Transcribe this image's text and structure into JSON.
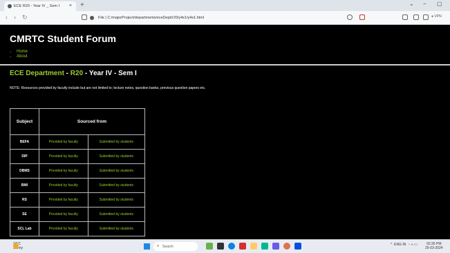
{
  "browser": {
    "tab_title": "ECE R20 - Year IV _ Sem I",
    "tab_close": "×",
    "new_tab": "+",
    "back": "‹",
    "forward": "›",
    "reload": "↻",
    "url": "File  |  C:/majorProject/departments/eceDept/r20/y4s1/y4s1.html",
    "vpn": "● VPN",
    "window_controls": [
      "⌄",
      "−",
      "▢"
    ]
  },
  "site": {
    "title": "CMRTC Student Forum",
    "nav": [
      "Home",
      "About"
    ]
  },
  "page": {
    "heading_dept": "ECE Department",
    "heading_sep1": " - ",
    "heading_reg": "R20",
    "heading_rest": " - Year IV - Sem I",
    "note": "NOTE: Resources provided by faculty include but are not limited to; lecture notes, question banks, previous question papers etc."
  },
  "table": {
    "header_subject": "Subject",
    "header_source": "Sourced from",
    "rows": [
      {
        "subject": "BEFA",
        "faculty": "Provided by faculty",
        "students": "Submitted by students"
      },
      {
        "subject": "DIP",
        "faculty": "Provided by faculty",
        "students": "Submitted by students"
      },
      {
        "subject": "DBMS",
        "faculty": "Provided by faculty",
        "students": "Submitted by students"
      },
      {
        "subject": "BMI",
        "faculty": "Provided by faculty",
        "students": "Submitted by students"
      },
      {
        "subject": "RS",
        "faculty": "Provided by faculty",
        "students": "Submitted by students"
      },
      {
        "subject": "SE",
        "faculty": "Provided by faculty",
        "students": "Submitted by students"
      },
      {
        "subject": "SCL Lab",
        "faculty": "Provided by faculty",
        "students": "Submitted by students"
      }
    ]
  },
  "taskbar": {
    "weather_temp": "34°C",
    "weather_desc": "Sunny",
    "search_placeholder": "Search",
    "tray_lang": "ENG IN",
    "time": "02:30 PM",
    "date": "25-03-2024"
  },
  "colors": {
    "accent_green": "#9acd32",
    "page_bg": "#000000"
  }
}
